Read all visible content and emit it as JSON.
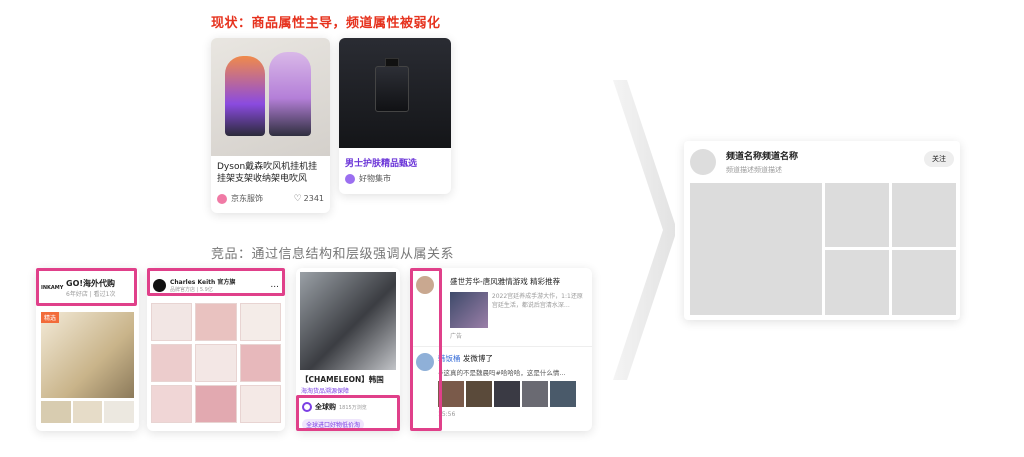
{
  "current": {
    "heading": "现状：商品属性主导，频道属性被弱化",
    "card1": {
      "title": "Dyson戴森吹风机挂机挂挂架支架收纳架电吹风",
      "source": "京东服饰",
      "likes": "2341"
    },
    "card2": {
      "title": "男士护肤精品甄选",
      "source": "好物集市"
    }
  },
  "competitor": {
    "heading": "竞品：通过信息结构和层级强调从属关系",
    "c1": {
      "name": "GO!海外代购",
      "meta": "6年好店 | 看过1次",
      "badge": "精选",
      "logo": "INKAMY"
    },
    "c2": {
      "name": "Charles Keith 官方旗",
      "meta": "品牌官方店 | 5.9亿",
      "more": "..."
    },
    "c3": {
      "caption": "【CHAMELEON】韩国",
      "sub": "海淘货品溯源保障",
      "name": "全球购",
      "count": "1815万浏览",
      "tag": "全球进口好物低价淘"
    },
    "c4": {
      "post1_title": "盛世芳华-唐风雅情游戏 精彩推荐",
      "post1_desc": "2022宫廷养成手游大作，1:1还原宫廷生活，都说后宫清水深…",
      "post2_user": "韩饭桶",
      "post2_action": "发微博了",
      "post2_text": "#这真的不是魏晨吗#哈哈哈，这是什么情...",
      "post2_time": "15:56",
      "post1_time": "广告"
    }
  },
  "proposal": {
    "channel_name": "频道名称频道名称",
    "channel_desc": "频道描述频道描述",
    "follow": "关注"
  },
  "colors": {
    "accent_red": "#e6321e",
    "highlight_pink": "#e0408a",
    "purple": "#7b3fe4"
  }
}
